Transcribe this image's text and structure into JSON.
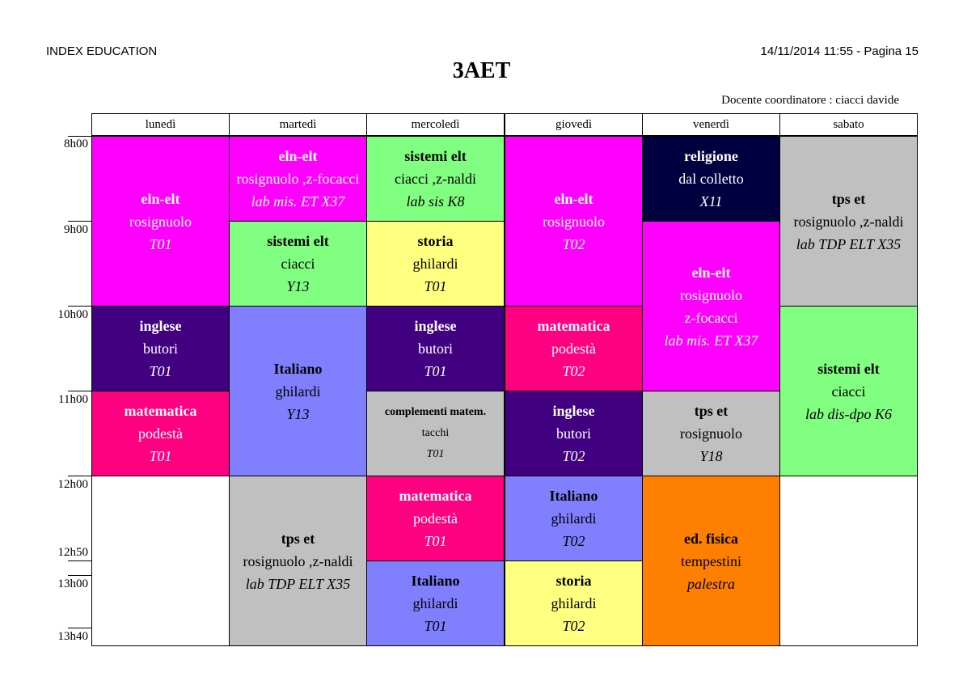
{
  "header": {
    "left": "INDEX EDUCATION",
    "right": "14/11/2014 11:55 - Pagina 15",
    "title": "3AET",
    "coordinator": "Docente coordinatore : ciacci davide"
  },
  "days": [
    "lunedì",
    "martedì",
    "mercoledì",
    "giovedì",
    "venerdì",
    "sabato"
  ],
  "times": [
    "8h00",
    "9h00",
    "10h00",
    "11h00",
    "12h00",
    "12h50",
    "13h00",
    "13h40"
  ],
  "colors": {
    "magenta": "#ff00ff",
    "green": "#80ff80",
    "dark_navy": "#000040",
    "gray": "#c0c0c0",
    "purple": "#400080",
    "yellow": "#ffff80",
    "pink": "#ff0080",
    "periwinkle": "#8080ff",
    "orange": "#ff8000"
  },
  "schedule": {
    "lun": [
      {
        "subject": "eln-elt",
        "teacher": "rosignuolo",
        "room": "T01"
      },
      {
        "subject": "inglese",
        "teacher": "butori",
        "room": "T01"
      },
      {
        "subject": "matematica",
        "teacher": "podestà",
        "room": "T01"
      }
    ],
    "mar": [
      {
        "subject": "eln-elt",
        "teacher": "rosignuolo ,z-focacci",
        "room": "lab mis. ET X37"
      },
      {
        "subject": "sistemi elt",
        "teacher": "ciacci",
        "room": "Y13"
      },
      {
        "subject": "Italiano",
        "teacher": "ghilardi",
        "room": "Y13"
      },
      {
        "subject": "tps et",
        "teacher": "rosignuolo ,z-naldi",
        "room": "lab TDP ELT X35"
      }
    ],
    "mer": [
      {
        "subject": "sistemi elt",
        "teacher": "ciacci ,z-naldi",
        "room": "lab sis K8"
      },
      {
        "subject": "storia",
        "teacher": "ghilardi",
        "room": "T01"
      },
      {
        "subject": "inglese",
        "teacher": "butori",
        "room": "T01"
      },
      {
        "subject": "complementi matem.",
        "teacher": "tacchi",
        "room": "T01"
      },
      {
        "subject": "matematica",
        "teacher": "podestà",
        "room": "T01"
      },
      {
        "subject": "Italiano",
        "teacher": "ghilardi",
        "room": "T01"
      }
    ],
    "gio": [
      {
        "subject": "eln-elt",
        "teacher": "rosignuolo",
        "room": "T02"
      },
      {
        "subject": "matematica",
        "teacher": "podestà",
        "room": "T02"
      },
      {
        "subject": "inglese",
        "teacher": "butori",
        "room": "T02"
      },
      {
        "subject": "Italiano",
        "teacher": "ghilardi",
        "room": "T02"
      },
      {
        "subject": "storia",
        "teacher": "ghilardi",
        "room": "T02"
      }
    ],
    "ven": [
      {
        "subject": "religione",
        "teacher": "dal colletto",
        "room": "X11"
      },
      {
        "subject": "eln-elt",
        "teacher": "rosignuolo",
        "teacher2": "z-focacci",
        "room": "lab mis. ET X37"
      },
      {
        "subject": "tps et",
        "teacher": "rosignuolo",
        "room": "Y18"
      },
      {
        "subject": "ed. fisica",
        "teacher": "tempestini",
        "room": "palestra"
      }
    ],
    "sab": [
      {
        "subject": "tps et",
        "teacher": "rosignuolo ,z-naldi",
        "room": "lab TDP ELT X35"
      },
      {
        "subject": "sistemi elt",
        "teacher": "ciacci",
        "room": "lab dis-dpo K6"
      }
    ]
  }
}
